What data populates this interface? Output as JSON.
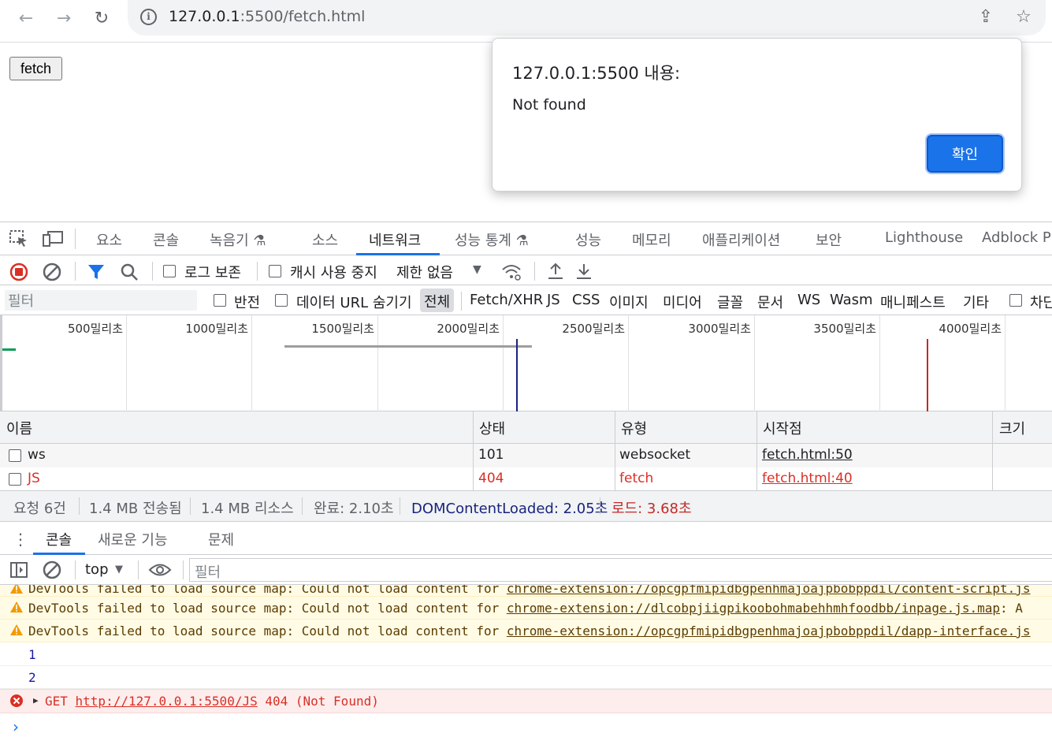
{
  "browser": {
    "url_host": "127.0.0.1",
    "url_path": ":5500/fetch.html"
  },
  "page": {
    "fetch_button": "fetch"
  },
  "alert": {
    "title": "127.0.0.1:5500 내용:",
    "message": "Not found",
    "ok_label": "확인"
  },
  "devtools": {
    "tabs": [
      "요소",
      "콘솔",
      "녹음기 ⚗",
      "소스",
      "네트워크",
      "성능 통계 ⚗",
      "성능",
      "메모리",
      "애플리케이션",
      "보안",
      "Lighthouse",
      "Adblock Plu"
    ],
    "active_tab": "네트워크",
    "network_toolbar": {
      "preserve_log": "로그 보존",
      "disable_cache": "캐시 사용 중지",
      "throttling": "제한 없음"
    },
    "filter_bar": {
      "placeholder": "필터",
      "invert": "반전",
      "hide_data_urls": "데이터 URL 숨기기",
      "types": [
        "전체",
        "Fetch/XHR",
        "JS",
        "CSS",
        "이미지",
        "미디어",
        "글꼴",
        "문서",
        "WS",
        "Wasm",
        "매니페스트",
        "기타"
      ],
      "blocked": "차단"
    },
    "timeline": {
      "ticks": [
        "500밀리초",
        "1000밀리초",
        "1500밀리초",
        "2000밀리초",
        "2500밀리초",
        "3000밀리초",
        "3500밀리초",
        "4000밀리초"
      ],
      "dom_content_loaded_ms": 2050,
      "load_ms": 3680
    },
    "table": {
      "headers": [
        "이름",
        "상태",
        "유형",
        "시작점",
        "크기"
      ],
      "rows": [
        {
          "name": "ws",
          "status": "101",
          "type": "websocket",
          "initiator": "fetch.html:50",
          "error": false
        },
        {
          "name": "JS",
          "status": "404",
          "type": "fetch",
          "initiator": "fetch.html:40",
          "error": true
        }
      ]
    },
    "summary": {
      "requests": "요청 6건",
      "transferred": "1.4 MB 전송됨",
      "resources": "1.4 MB 리소스",
      "finish": "완료: 2.10초",
      "dcl": "DOMContentLoaded: 2.05초",
      "load": "로드: 3.68초"
    },
    "drawer_tabs": [
      "콘솔",
      "새로운 기능",
      "문제"
    ],
    "console_toolbar": {
      "context": "top",
      "filter_placeholder": "필터"
    },
    "console": {
      "lines": [
        {
          "kind": "warn",
          "prefix": "DevTools failed to load source map: Could not load content for ",
          "link": "chrome-extension://opcgpfmipidbgpenhmajoajpbobppdil/content-script.js",
          "suffix": ""
        },
        {
          "kind": "warn",
          "prefix": "DevTools failed to load source map: Could not load content for ",
          "link": "chrome-extension://dlcobpjiigpikoobohmabehhmhfoodbb/inpage.js.map",
          "suffix": ": A"
        },
        {
          "kind": "warn",
          "prefix": "DevTools failed to load source map: Could not load content for ",
          "link": "chrome-extension://opcgpfmipidbgpenhmajoajpbobppdil/dapp-interface.js",
          "suffix": ""
        },
        {
          "kind": "log",
          "text": "1"
        },
        {
          "kind": "log",
          "text": "2"
        },
        {
          "kind": "error",
          "prefix": "GET ",
          "link": "http://127.0.0.1:5500/JS",
          "suffix": " 404 (Not Found)"
        }
      ],
      "prompt": "›"
    }
  },
  "colors": {
    "accent": "#1a73e8",
    "error": "#d93025",
    "dcl_marker": "#1a237e",
    "load_marker": "#c62828"
  }
}
